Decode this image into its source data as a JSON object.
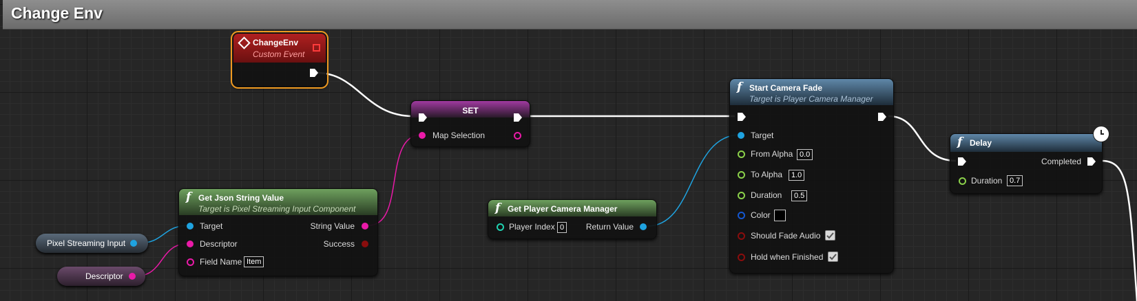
{
  "graph": {
    "title": "Change Env"
  },
  "nodes": {
    "change_env": {
      "title": "ChangeEnv",
      "subtitle": "Custom Event"
    },
    "set": {
      "title": "SET",
      "pin_map_selection": "Map Selection"
    },
    "get_json": {
      "title": "Get Json String Value",
      "subtitle": "Target is Pixel Streaming Input Component",
      "pin_target": "Target",
      "pin_descriptor": "Descriptor",
      "pin_field_name": "Field Name",
      "field_name_value": "Item",
      "pin_string_value": "String Value",
      "pin_success": "Success"
    },
    "pixel_streaming_input": {
      "label": "Pixel Streaming Input"
    },
    "descriptor_var": {
      "label": "Descriptor"
    },
    "get_camera_manager": {
      "title": "Get Player Camera Manager",
      "pin_player_index": "Player Index",
      "player_index_value": "0",
      "pin_return_value": "Return Value"
    },
    "start_camera_fade": {
      "title": "Start Camera Fade",
      "subtitle": "Target is Player Camera Manager",
      "pin_target": "Target",
      "pin_from_alpha": "From Alpha",
      "from_alpha_value": "0.0",
      "pin_to_alpha": "To Alpha",
      "to_alpha_value": "1.0",
      "pin_duration": "Duration",
      "duration_value": "0.5",
      "pin_color": "Color",
      "color_value": "#000000",
      "pin_should_fade_audio": "Should Fade Audio",
      "should_fade_audio": true,
      "pin_hold_when_finished": "Hold when Finished",
      "hold_when_finished": true
    },
    "delay": {
      "title": "Delay",
      "pin_completed": "Completed",
      "pin_duration": "Duration",
      "duration_value": "0.7"
    }
  },
  "colors": {
    "event_header": "#8b1a1a",
    "function_header": "#3b5f7d",
    "pure_header": "#4b7a3b",
    "set_header": "#7b2a7b",
    "object_pin": "#1fa3e0",
    "string_pin": "#ea1aa8",
    "bool_pin": "#8a0d0d",
    "float_pin": "#8bd14a",
    "int_pin": "#1fd3b1",
    "struct_pin": "#1457d1",
    "selection": "#f09a20"
  },
  "icons": [
    "event-diamond-icon",
    "function-icon",
    "clock-icon",
    "exec-pin-icon",
    "checkbox-icon"
  ]
}
